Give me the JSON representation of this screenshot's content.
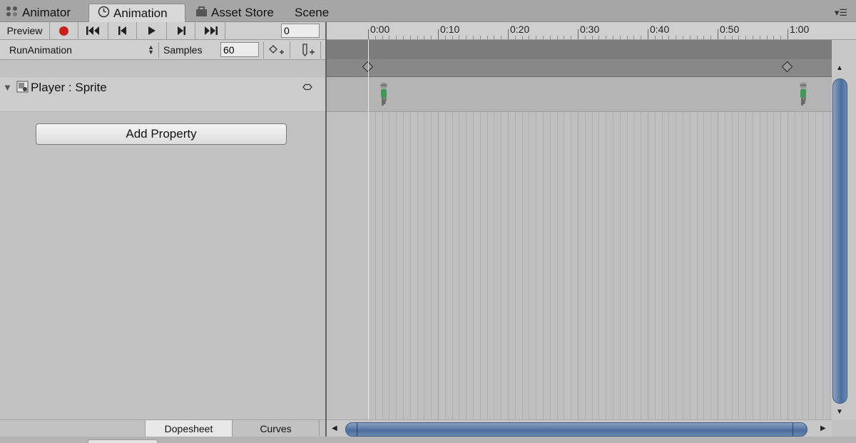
{
  "tabs": {
    "animator": "Animator",
    "animation": "Animation",
    "asset_store": "Asset Store",
    "scene": "Scene",
    "menu_icon": "panel-menu-icon"
  },
  "toolbar": {
    "preview_label": "Preview",
    "record_icon": "record-icon",
    "first_key_icon": "first-keyframe-icon",
    "prev_key_icon": "previous-keyframe-icon",
    "play_icon": "play-icon",
    "next_key_icon": "next-keyframe-icon",
    "last_key_icon": "last-keyframe-icon",
    "current_frame": "0",
    "record_color": "#c8211c"
  },
  "clip": {
    "selected": "RunAnimation",
    "samples_label": "Samples",
    "samples_value": "60",
    "add_keyframe_icon": "add-keyframe-icon",
    "add_event_icon": "add-event-icon"
  },
  "properties": {
    "items": [
      {
        "label": "Player : Sprite",
        "icon": "sprite-renderer-icon"
      }
    ],
    "add_property_label": "Add Property"
  },
  "timeline": {
    "ticks": [
      "0:00",
      "0:10",
      "0:20",
      "0:30",
      "0:40",
      "0:50",
      "1:00"
    ],
    "keyframes_sec": [
      0,
      60
    ],
    "playhead_frame": 0
  },
  "bottom_tabs": {
    "dopesheet": "Dopesheet",
    "curves": "Curves"
  },
  "colors": {
    "scrollbar_thumb": "#4c6d9c",
    "record": "#c8211c"
  }
}
